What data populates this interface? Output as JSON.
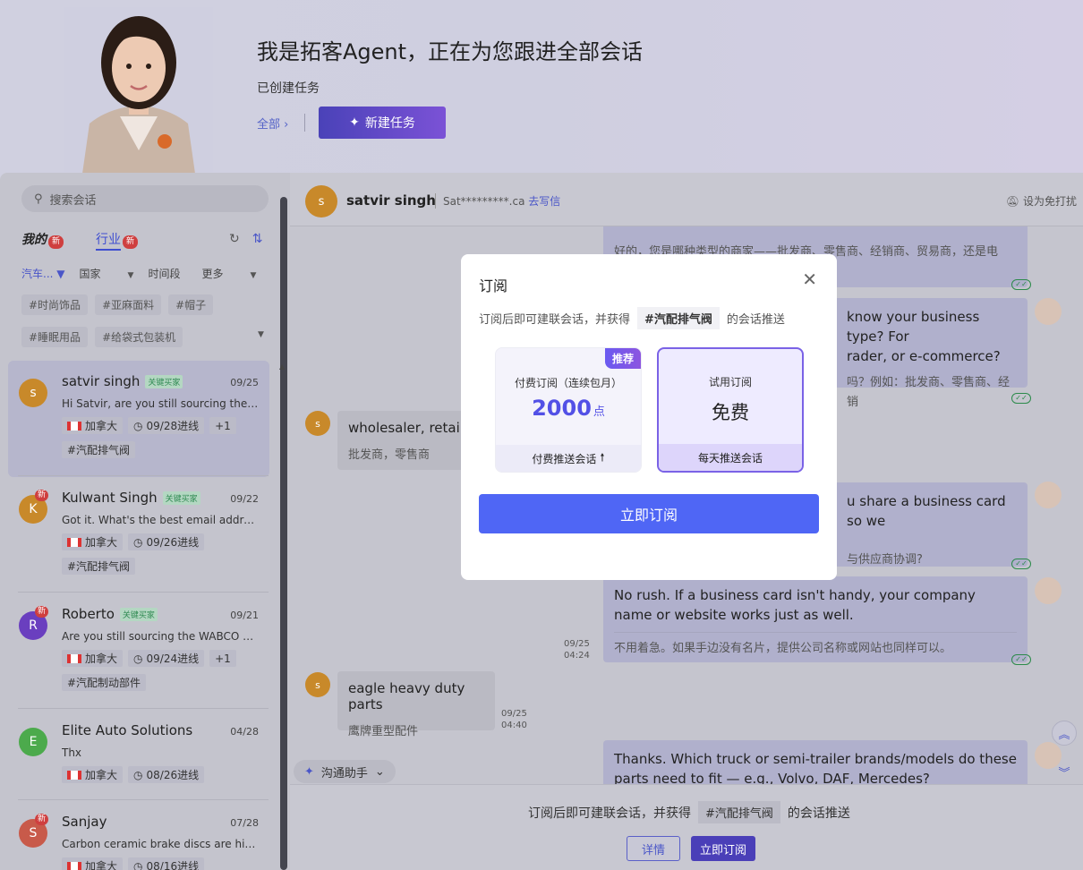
{
  "hero": {
    "title": "我是拓客Agent，正在为您跟进全部会话",
    "subtitle": "已创建任务",
    "filter_all": "全部 ›",
    "new_task_button": "新建任务"
  },
  "sidebar": {
    "search_placeholder": "搜索会话",
    "tab_mine": "我的",
    "tab_industry": "行业",
    "new_badge": "新",
    "filters": [
      "汽车...",
      "国家",
      "时间段",
      "更多"
    ],
    "tags_row1": [
      "#时尚饰品",
      "#亚麻面料",
      "#帽子"
    ],
    "tags_row2": [
      "#睡眠用品",
      "#给袋式包装机"
    ],
    "conversations": [
      {
        "initial": "s",
        "name": "satvir singh",
        "badge": "关键买家",
        "date": "09/25",
        "preview": "Hi Satvir, are you still sourcing the ai...",
        "country": "加拿大",
        "followup": "09/28进线",
        "extra": "+1",
        "tag": "#汽配排气阀",
        "is_new": false,
        "color": "#c8892a"
      },
      {
        "initial": "K",
        "name": "Kulwant Singh",
        "badge": "关键买家",
        "date": "09/22",
        "preview": "Got it. What's the best email addres...",
        "country": "加拿大",
        "followup": "09/26进线",
        "extra": "",
        "tag": "#汽配排气阀",
        "is_new": true,
        "color": "#c8892a"
      },
      {
        "initial": "R",
        "name": "Roberto",
        "badge": "关键买家",
        "date": "09/21",
        "preview": "Are you still sourcing the WABCO A...",
        "country": "加拿大",
        "followup": "09/24进线",
        "extra": "+1",
        "tag": "#汽配制动部件",
        "is_new": true,
        "color": "#6a3fbf"
      },
      {
        "initial": "E",
        "name": "Elite Auto Solutions",
        "badge": "",
        "date": "04/28",
        "preview": "Thx",
        "country": "加拿大",
        "followup": "08/26进线",
        "extra": "",
        "tag": "",
        "is_new": false,
        "color": "#4caa4c"
      },
      {
        "initial": "S",
        "name": "Sanjay",
        "badge": "",
        "date": "07/28",
        "preview": "Carbon ceramic brake discs are high...",
        "country": "加拿大",
        "followup": "08/16进线",
        "extra": "",
        "tag": "",
        "is_new": true,
        "color": "#c85a4a"
      }
    ]
  },
  "chat": {
    "contact_initial": "s",
    "contact_name": "satvir singh",
    "email_masked": "Sat*********.ca",
    "write_email": "去写信",
    "dnd": "设为免打扰",
    "messages": {
      "m1_tr": "好的，您是哪种类型的商家——批发商、零售商、经销商、贸易商，还是电",
      "m2": "know your business type? For",
      "m2b": "rader, or e-commerce?",
      "m2_tr": "吗？例如：批发商、零售商、经销",
      "m3": "wholesaler, retailer",
      "m3_tr": "批发商，零售商",
      "m4": "u share a business card so we",
      "m4_tr": "与供应商协调?",
      "m5": "No rush. If a business card isn't handy, your company name or website works just as well.",
      "m5_tr": "不用着急。如果手边没有名片，提供公司名称或网站也同样可以。",
      "m5_date": "09/25",
      "m5_time": "04:24",
      "m6": "eagle heavy duty parts",
      "m6_tr": "鹰牌重型配件",
      "m6_date": "09/25",
      "m6_time": "04:40",
      "m7": "Thanks. Which truck or semi-trailer brands/models do these parts need to fit — e.g., Volvo, DAF, Mercedes?"
    },
    "assistant": "沟通助手",
    "bottom_text_before": "订阅后即可建联会话，并获得",
    "bottom_tag": "#汽配排气阀",
    "bottom_text_after": "的会话推送",
    "detail_button": "详情",
    "subscribe_button": "立即订阅"
  },
  "modal": {
    "title": "订阅",
    "desc_before": "订阅后即可建联会话，并获得",
    "desc_tag": "#汽配排气阀",
    "desc_after": "的会话推送",
    "paid": {
      "recommend": "推荐",
      "name": "付费订阅（连续包月）",
      "price": "2000",
      "unit": "点",
      "footer": "付费推送会话"
    },
    "free": {
      "name": "试用订阅",
      "price": "免费",
      "footer": "每天推送会话"
    },
    "confirm": "立即订阅"
  },
  "colors": {
    "accent": "#4f66f5",
    "brand_purple": "#7a62e6",
    "new_badge": "#cf3f3f"
  }
}
